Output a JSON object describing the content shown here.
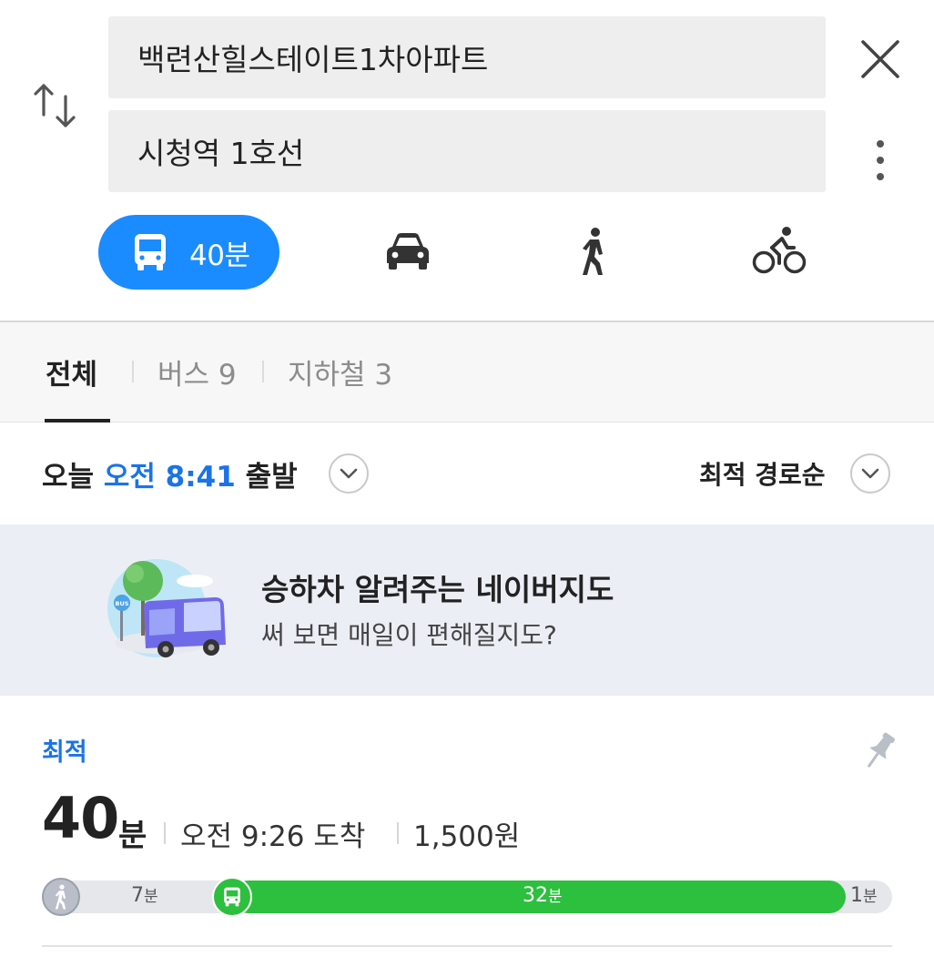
{
  "search": {
    "origin": "백련산힐스테이트1차아파트",
    "destination": "시청역 1호선"
  },
  "icons": {
    "swap": "swap-arrows-icon",
    "close": "close-icon",
    "more": "more-vertical-icon",
    "bus": "bus-icon",
    "car": "car-icon",
    "walk": "walk-icon",
    "bike": "bicycle-icon",
    "pin": "pin-icon",
    "chevron": "chevron-down-icon"
  },
  "modes": {
    "transit_duration": "40분"
  },
  "filter_tabs": [
    {
      "label": "전체",
      "active": true
    },
    {
      "label": "버스 9",
      "active": false
    },
    {
      "label": "지하철 3",
      "active": false
    }
  ],
  "departure": {
    "prefix": "오늘",
    "time": "오전 8:41",
    "suffix": "출발"
  },
  "sort": {
    "label": "최적 경로순"
  },
  "banner": {
    "title": "승하차 알려주는 네이버지도",
    "subtitle": "써 보면 매일이 편해질지도?",
    "bus_sign": "BUS"
  },
  "route": {
    "badge": "최적",
    "duration_value": "40",
    "duration_unit": "분",
    "arrival": "오전 9:26 도착",
    "fare": "1,500원",
    "segments": [
      {
        "mode": "walk",
        "minutes": "7",
        "unit": "분"
      },
      {
        "mode": "bus",
        "minutes": "32",
        "unit": "분"
      },
      {
        "mode": "walk",
        "minutes": "1",
        "unit": "분"
      }
    ]
  },
  "colors": {
    "accent": "#1a8cff",
    "bus_segment": "#2dbf3e",
    "highlight_text": "#1a73e8"
  }
}
